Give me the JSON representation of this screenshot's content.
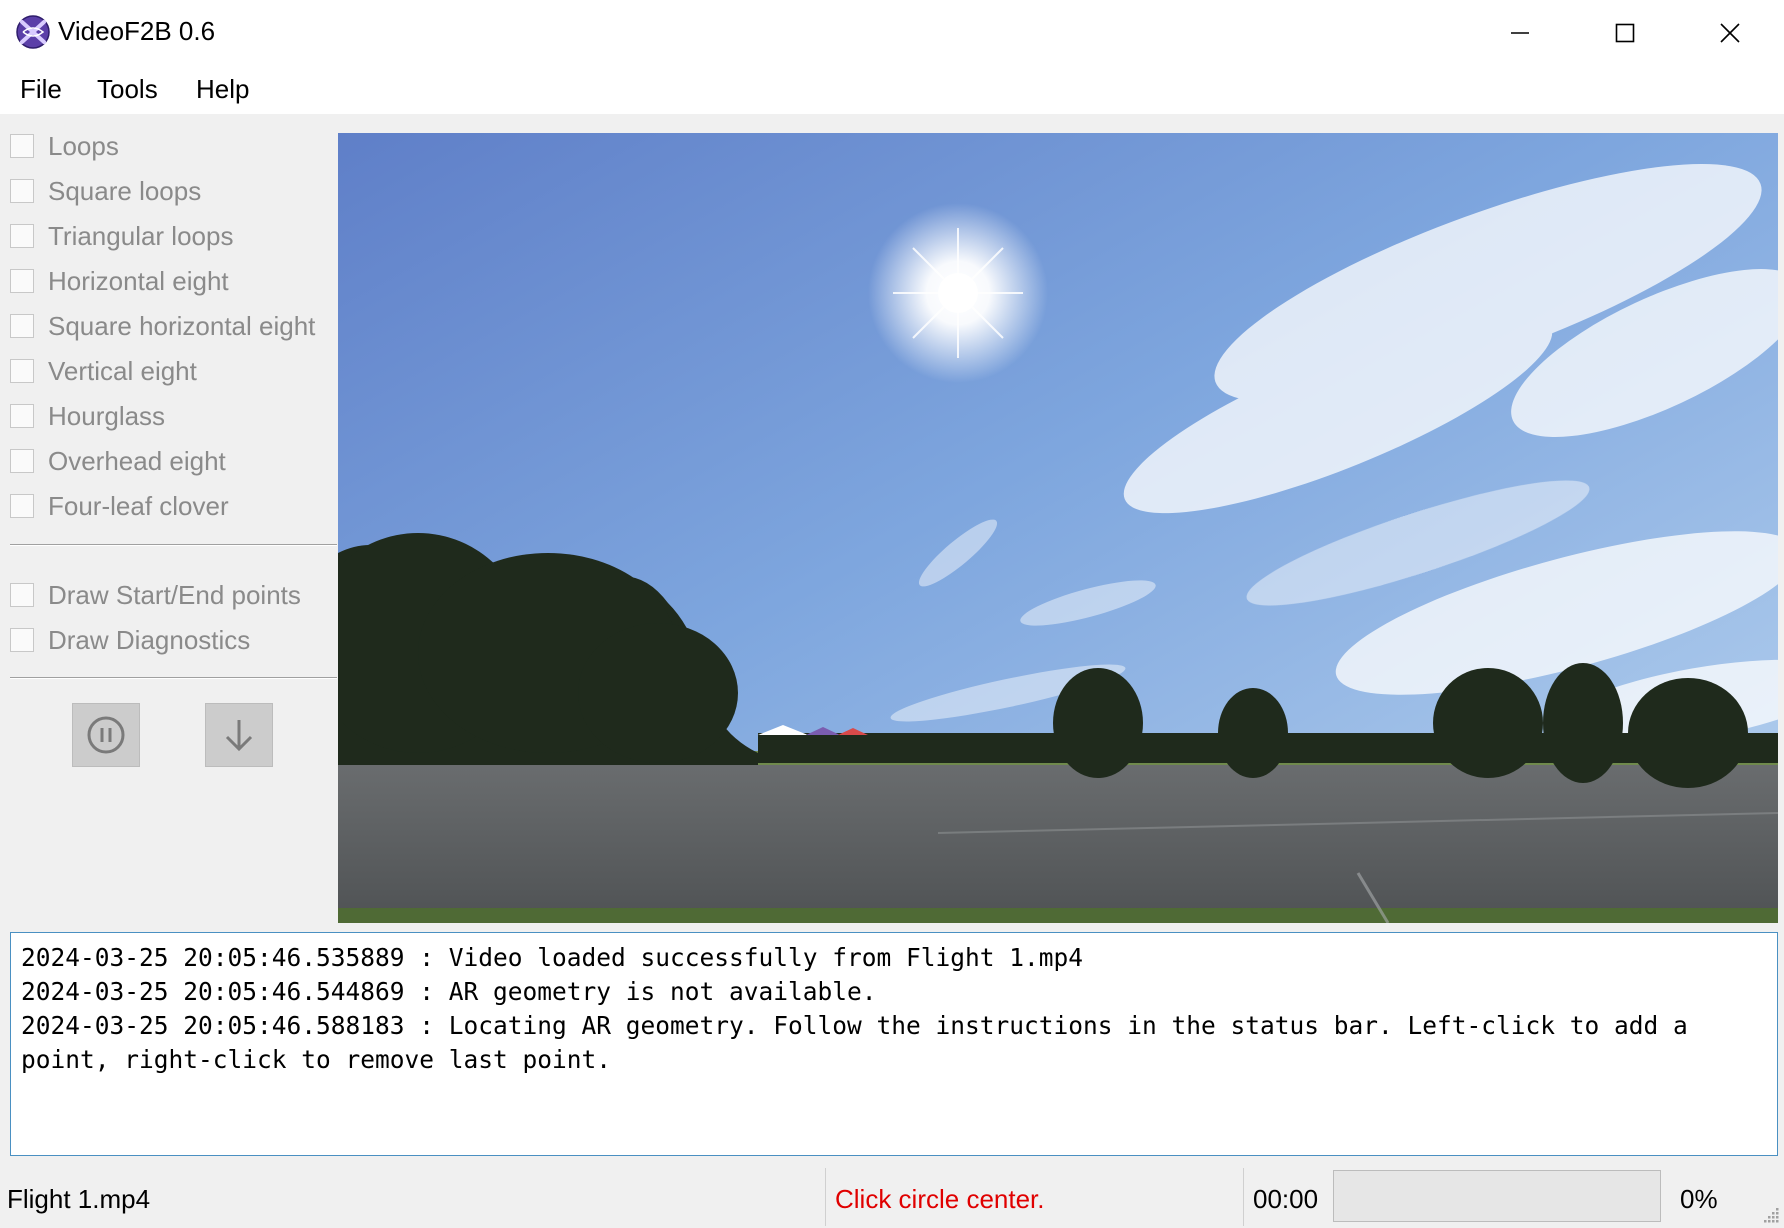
{
  "window": {
    "title": "VideoF2B 0.6",
    "icon": "videof2b-logo-icon"
  },
  "menu": [
    "File",
    "Tools",
    "Help"
  ],
  "figures": [
    {
      "label": "Loops",
      "checked": false
    },
    {
      "label": "Square loops",
      "checked": false
    },
    {
      "label": "Triangular loops",
      "checked": false
    },
    {
      "label": "Horizontal eight",
      "checked": false
    },
    {
      "label": "Square horizontal eight",
      "checked": false
    },
    {
      "label": "Vertical eight",
      "checked": false
    },
    {
      "label": "Hourglass",
      "checked": false
    },
    {
      "label": "Overhead eight",
      "checked": false
    },
    {
      "label": "Four-leaf clover",
      "checked": false
    }
  ],
  "options": [
    {
      "label": "Draw Start/End points",
      "checked": false
    },
    {
      "label": "Draw Diagnostics",
      "checked": false
    }
  ],
  "controls": {
    "pause_icon": "pause-circle-icon",
    "advance_icon": "arrow-down-icon"
  },
  "log": [
    "2024-03-25 20:05:46.535889 : Video loaded successfully from Flight 1.mp4",
    "2024-03-25 20:05:46.544869 : AR geometry is not available.",
    "2024-03-25 20:05:46.588183 : Locating AR geometry. Follow the instructions in the status bar. Left-click to add a point, right-click to remove last point."
  ],
  "status": {
    "file": "Flight 1.mp4",
    "instruction": "Click circle center.",
    "instruction_color": "#e00000",
    "time": "00:00",
    "progress_percent": 0,
    "progress_label": "0%"
  },
  "colors": {
    "log_border": "#4a90c2",
    "disabled_text": "#8a8a8a"
  }
}
